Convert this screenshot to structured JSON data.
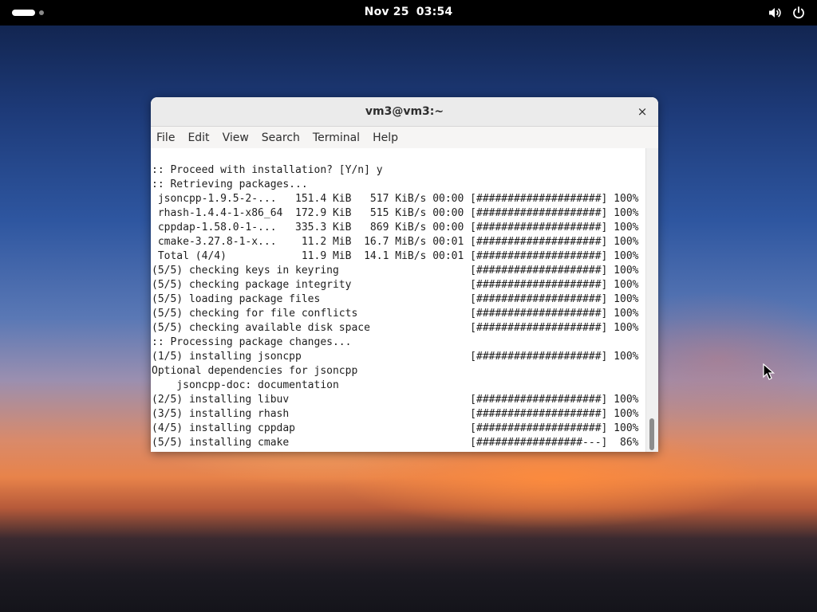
{
  "topbar": {
    "date": "Nov 25",
    "time": "03:54",
    "icons": [
      "volume-icon",
      "power-icon"
    ]
  },
  "window": {
    "title": "vm3@vm3:~",
    "close_label": "×",
    "menu": [
      "File",
      "Edit",
      "View",
      "Search",
      "Terminal",
      "Help"
    ]
  },
  "terminal": {
    "lines": [
      ":: Proceed with installation? [Y/n] y",
      ":: Retrieving packages...",
      " jsoncpp-1.9.5-2-...   151.4 KiB   517 KiB/s 00:00 [####################] 100%",
      " rhash-1.4.4-1-x86_64  172.9 KiB   515 KiB/s 00:00 [####################] 100%",
      " cppdap-1.58.0-1-...   335.3 KiB   869 KiB/s 00:00 [####################] 100%",
      " cmake-3.27.8-1-x...    11.2 MiB  16.7 MiB/s 00:01 [####################] 100%",
      " Total (4/4)            11.9 MiB  14.1 MiB/s 00:01 [####################] 100%",
      "(5/5) checking keys in keyring                     [####################] 100%",
      "(5/5) checking package integrity                   [####################] 100%",
      "(5/5) loading package files                        [####################] 100%",
      "(5/5) checking for file conflicts                  [####################] 100%",
      "(5/5) checking available disk space                [####################] 100%",
      ":: Processing package changes...",
      "(1/5) installing jsoncpp                           [####################] 100%",
      "Optional dependencies for jsoncpp",
      "    jsoncpp-doc: documentation",
      "(2/5) installing libuv                             [####################] 100%",
      "(3/5) installing rhash                             [####################] 100%",
      "(4/5) installing cppdap                            [####################] 100%",
      "(5/5) installing cmake                             [#################---]  86%"
    ]
  },
  "colors": {
    "topbar_bg": "#000000",
    "window_bg": "#ffffff",
    "titlebar_bg": "#ebebeb"
  }
}
